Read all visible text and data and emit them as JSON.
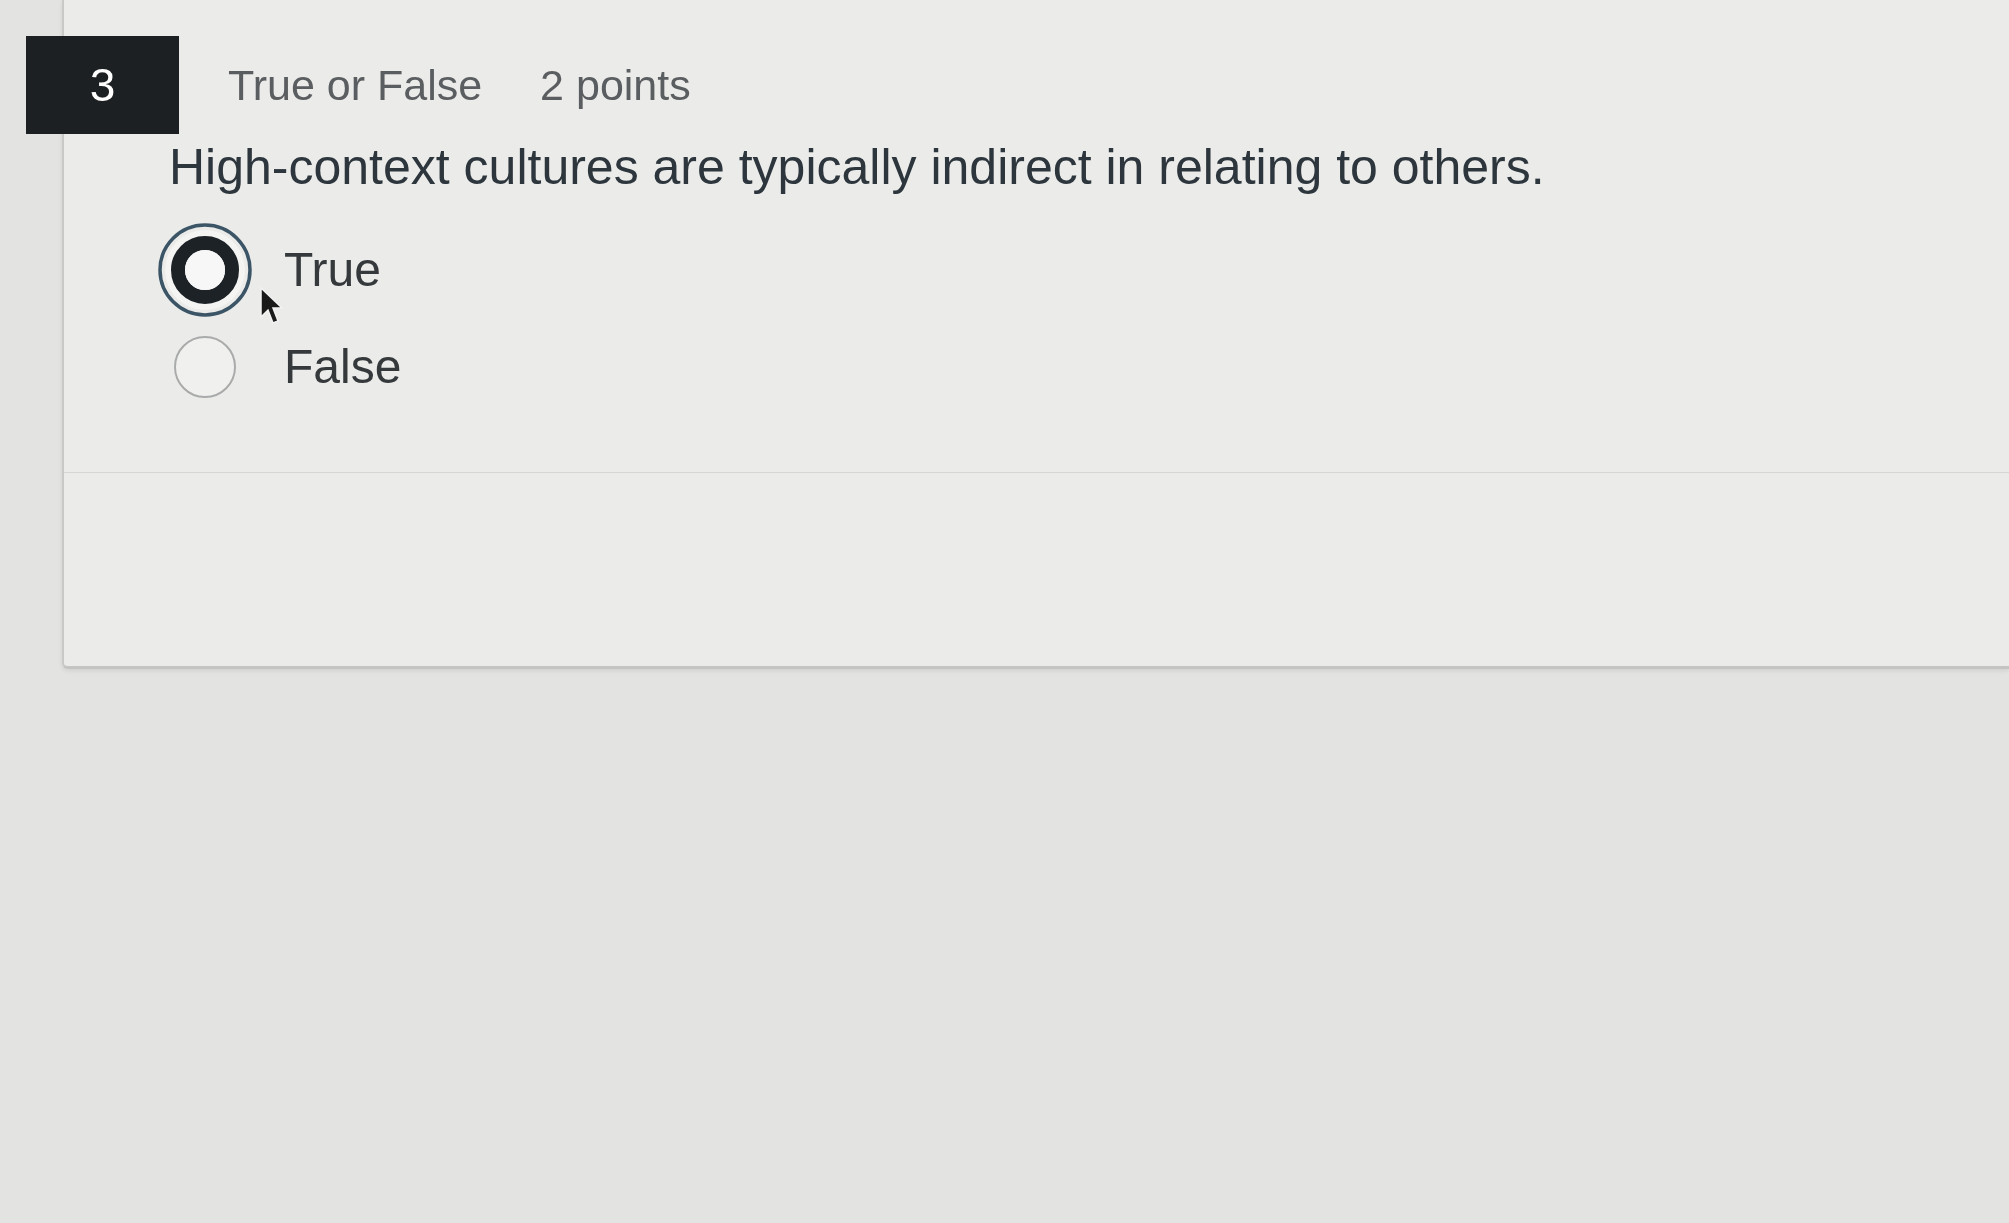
{
  "question": {
    "number": "3",
    "type_label": "True or False",
    "points": "2 points",
    "text": "High-context cultures are typically indirect in relating to others.",
    "answers": [
      {
        "label": "True",
        "selected": true
      },
      {
        "label": "False",
        "selected": false
      }
    ]
  }
}
